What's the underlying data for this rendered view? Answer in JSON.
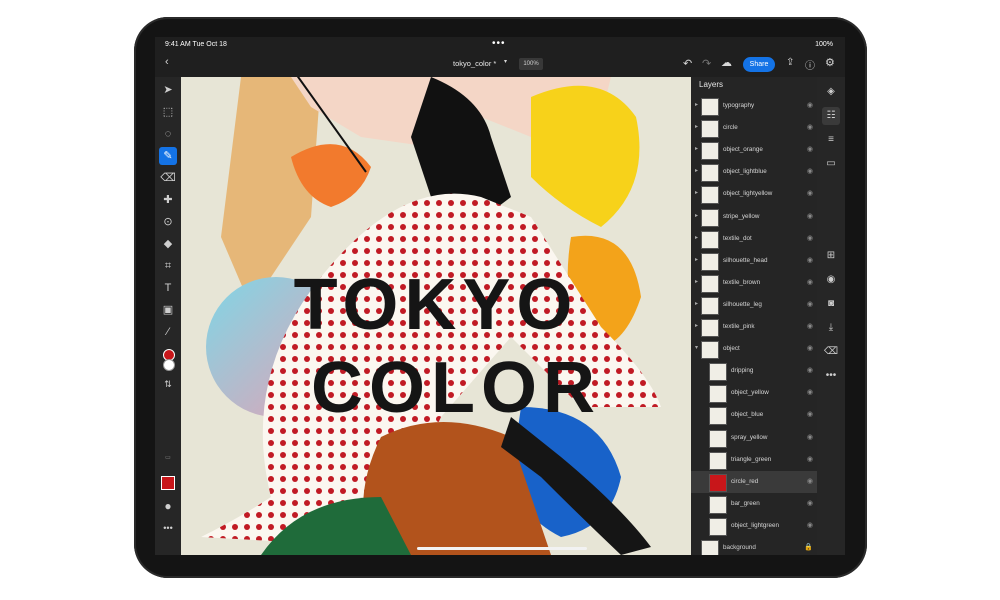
{
  "status_bar": {
    "time": "9:41 AM  Tue Oct 18",
    "battery": "100%"
  },
  "top_bar": {
    "document_title": "tokyo_color *",
    "zoom": "100%",
    "share_label": "Share"
  },
  "colors": {
    "accent": "#1473e6",
    "foreground_swatch": "#c8161a",
    "background_swatch": "#ffffff"
  },
  "artwork": {
    "line1": "TOKYO",
    "line2": "COLOR"
  },
  "layers_panel": {
    "title": "Layers",
    "layers": [
      {
        "name": "typography"
      },
      {
        "name": "circle"
      },
      {
        "name": "object_orange"
      },
      {
        "name": "object_lightblue"
      },
      {
        "name": "object_lightyellow"
      },
      {
        "name": "stripe_yellow"
      },
      {
        "name": "textile_dot"
      },
      {
        "name": "silhouette_head"
      },
      {
        "name": "textile_brown"
      },
      {
        "name": "silhouette_leg"
      },
      {
        "name": "textile_pink"
      },
      {
        "name": "object"
      },
      {
        "name": "dripping"
      },
      {
        "name": "object_yellow"
      },
      {
        "name": "object_blue"
      },
      {
        "name": "spray_yellow"
      },
      {
        "name": "triangle_green"
      },
      {
        "name": "circle_red"
      },
      {
        "name": "bar_green"
      },
      {
        "name": "object_lightgreen"
      },
      {
        "name": "background"
      }
    ],
    "selected": "circle_red"
  },
  "left_tools": [
    "select-icon",
    "transform-icon",
    "lasso-icon",
    "brush-icon",
    "eraser-icon",
    "healing-icon",
    "clone-icon",
    "fill-icon",
    "crop-icon",
    "type-icon",
    "place-image-icon",
    "eyedropper-icon"
  ],
  "right_tools": [
    "layers-icon",
    "layer-properties-icon",
    "adjustments-icon",
    "comments-icon",
    "add-layer-icon",
    "visibility-icon",
    "mask-icon",
    "import-icon",
    "eraser-layer-icon",
    "more-icon"
  ]
}
